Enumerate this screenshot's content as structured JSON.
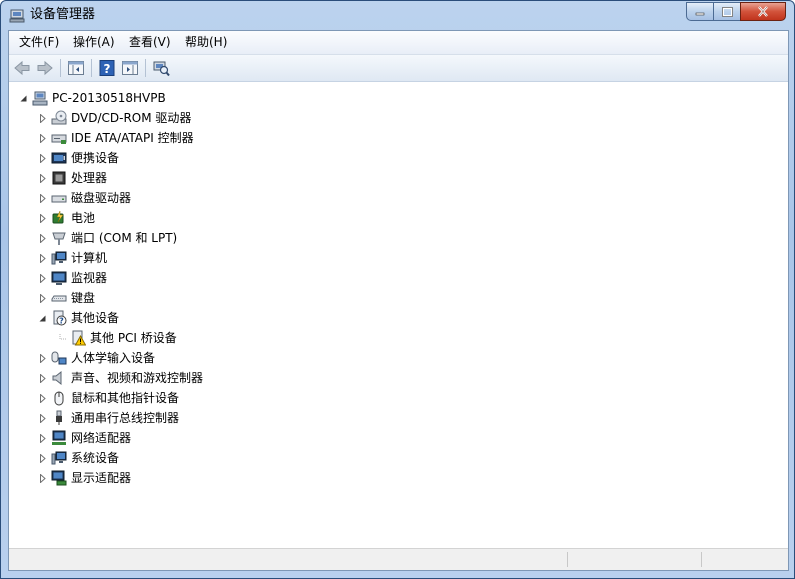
{
  "window": {
    "title": "设备管理器"
  },
  "menu": [
    "文件(F)",
    "操作(A)",
    "查看(V)",
    "帮助(H)"
  ],
  "tree": {
    "root": "PC-20130518HVPB",
    "categories": [
      {
        "label": "DVD/CD-ROM 驱动器",
        "icon": "dvd-drive-icon",
        "expanded": false
      },
      {
        "label": "IDE ATA/ATAPI 控制器",
        "icon": "ide-controller-icon",
        "expanded": false
      },
      {
        "label": "便携设备",
        "icon": "portable-device-icon",
        "expanded": false
      },
      {
        "label": "处理器",
        "icon": "processor-icon",
        "expanded": false
      },
      {
        "label": "磁盘驱动器",
        "icon": "disk-drive-icon",
        "expanded": false
      },
      {
        "label": "电池",
        "icon": "battery-icon",
        "expanded": false
      },
      {
        "label": "端口 (COM 和 LPT)",
        "icon": "port-icon",
        "expanded": false
      },
      {
        "label": "计算机",
        "icon": "computer-icon",
        "expanded": false
      },
      {
        "label": "监视器",
        "icon": "monitor-icon",
        "expanded": false
      },
      {
        "label": "键盘",
        "icon": "keyboard-icon",
        "expanded": false
      },
      {
        "label": "其他设备",
        "icon": "other-devices-icon",
        "expanded": true,
        "children": [
          {
            "label": "其他 PCI 桥设备",
            "icon": "warning-device-icon"
          }
        ]
      },
      {
        "label": "人体学输入设备",
        "icon": "hid-icon",
        "expanded": false
      },
      {
        "label": "声音、视频和游戏控制器",
        "icon": "sound-icon",
        "expanded": false
      },
      {
        "label": "鼠标和其他指针设备",
        "icon": "mouse-icon",
        "expanded": false
      },
      {
        "label": "通用串行总线控制器",
        "icon": "usb-icon",
        "expanded": false
      },
      {
        "label": "网络适配器",
        "icon": "network-adapter-icon",
        "expanded": false
      },
      {
        "label": "系统设备",
        "icon": "system-device-icon",
        "expanded": false
      },
      {
        "label": "显示适配器",
        "icon": "display-adapter-icon",
        "expanded": false
      }
    ]
  },
  "colors": {
    "accent": "#1f4e8c",
    "close": "#c7432a"
  }
}
